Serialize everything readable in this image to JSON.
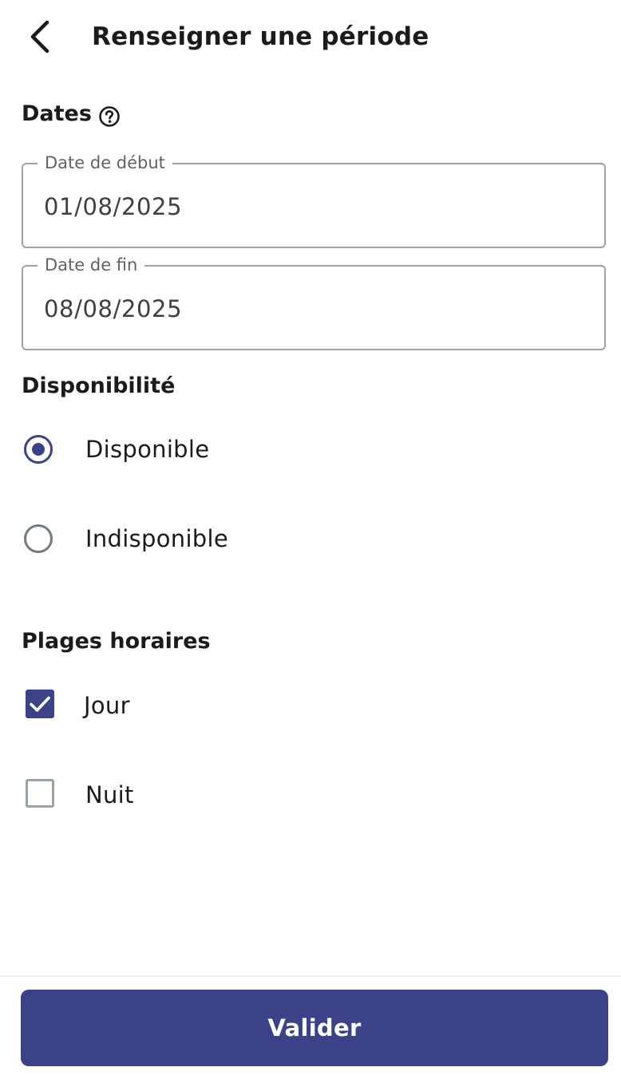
{
  "header": {
    "title": "Renseigner une période",
    "back_icon": "chevron-left-icon"
  },
  "dates": {
    "title": "Dates",
    "help_icon": "question-circle-icon",
    "start": {
      "label": "Date de début",
      "value": "01/08/2025"
    },
    "end": {
      "label": "Date de fin",
      "value": "08/08/2025"
    }
  },
  "availability": {
    "title": "Disponibilité",
    "options": [
      {
        "label": "Disponible",
        "selected": true
      },
      {
        "label": "Indisponible",
        "selected": false
      }
    ]
  },
  "time_slots": {
    "title": "Plages horaires",
    "options": [
      {
        "label": "Jour",
        "checked": true
      },
      {
        "label": "Nuit",
        "checked": false
      }
    ]
  },
  "footer": {
    "submit_label": "Valider"
  },
  "colors": {
    "primary": "#3b4287",
    "border": "#9aa3a8",
    "text": "#1b1b1f"
  }
}
